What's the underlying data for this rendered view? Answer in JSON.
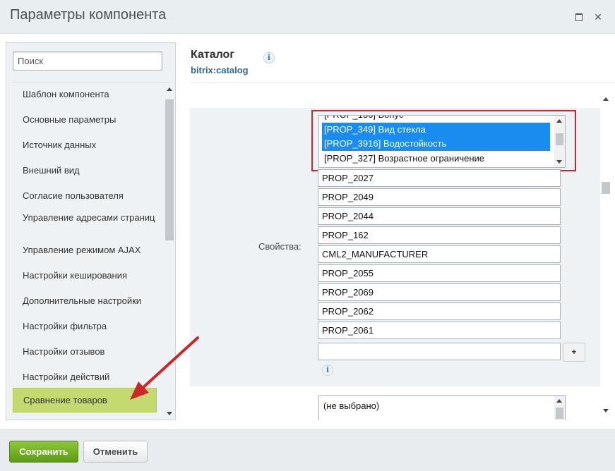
{
  "window": {
    "title": "Параметры компонента",
    "maximize_icon": "maximize-icon",
    "close_icon": "close-icon",
    "close_glyph": "✕"
  },
  "sidebar": {
    "search_placeholder": "Поиск",
    "items": [
      {
        "label": "Шаблон компонента",
        "active": false
      },
      {
        "label": "Основные параметры",
        "active": false
      },
      {
        "label": "Источник данных",
        "active": false
      },
      {
        "label": "Внешний вид",
        "active": false
      },
      {
        "label": "Согласие пользователя",
        "active": false
      },
      {
        "label": "Управление адресами страниц",
        "active": false
      },
      {
        "label": "Управление режимом AJAX",
        "active": false
      },
      {
        "label": "Настройки кеширования",
        "active": false
      },
      {
        "label": "Дополнительные настройки",
        "active": false
      },
      {
        "label": "Настройки фильтра",
        "active": false
      },
      {
        "label": "Настройки отзывов",
        "active": false
      },
      {
        "label": "Настройки действий",
        "active": false
      },
      {
        "label": "Сравнение товаров",
        "active": true
      }
    ],
    "active_color": "#c4d96f"
  },
  "component": {
    "title": "Каталог",
    "code": "bitrix:catalog",
    "info_glyph": "i"
  },
  "properties": {
    "label": "Свойства:",
    "multiselect_options": [
      {
        "label": "[PROP_349] Вид стекла",
        "selected": true
      },
      {
        "label": "[PROP_3916] Водостойкость",
        "selected": true
      },
      {
        "label": "[PROP_327] Возрастное ограничение",
        "selected": false
      }
    ],
    "inputs": [
      "PROP_2027",
      "PROP_2049",
      "PROP_2044",
      "PROP_162",
      "CML2_MANUFACTURER",
      "PROP_2055",
      "PROP_2069",
      "PROP_2062",
      "PROP_2061",
      ""
    ],
    "add_button": "+",
    "info_glyph": "i",
    "highlight_color": "#c8282c",
    "selected_color": "#1a8cf0"
  },
  "second_select": {
    "options": [
      "(не выбрано)"
    ]
  },
  "annotation": {
    "arrow_color": "#c8282c"
  },
  "footer": {
    "save_label": "Сохранить",
    "cancel_label": "Отменить"
  }
}
